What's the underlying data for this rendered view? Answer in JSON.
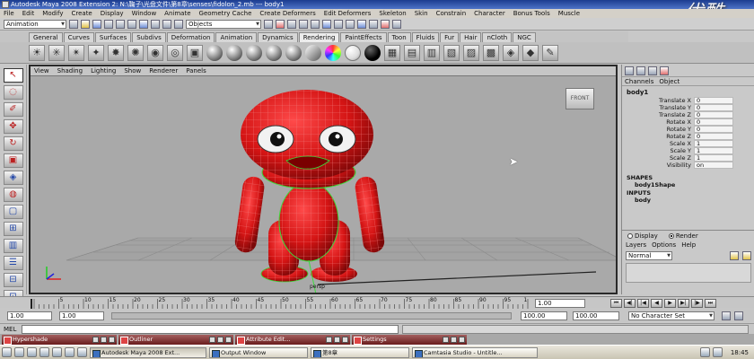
{
  "window": {
    "title": "Autodesk Maya 2008 Extension 2: N:\\鞠子\\光盘文件\\第8章\\senses\\fidolon_2.mb  ---  body1"
  },
  "watermark": "优酷",
  "menubar": [
    "File",
    "Edit",
    "Modify",
    "Create",
    "Display",
    "Window",
    "Animate",
    "Geometry Cache",
    "Create Deformers",
    "Edit Deformers",
    "Skeleton",
    "Skin",
    "Constrain",
    "Character",
    "Bonus Tools",
    "Muscle"
  ],
  "statusline": {
    "mode": "Animation",
    "selection_mode": "Objects"
  },
  "shelf_tabs": [
    "General",
    "Curves",
    "Surfaces",
    "Subdivs",
    "Deformation",
    "Animation",
    "Dynamics",
    "Rendering",
    "PaintEffects",
    "Toon",
    "Fluids",
    "Fur",
    "Hair",
    "nCloth",
    "NGC"
  ],
  "active_shelf_tab": "Rendering",
  "viewport": {
    "menu": [
      "View",
      "Shading",
      "Lighting",
      "Show",
      "Renderer",
      "Panels"
    ],
    "viewcube_label": "FRONT",
    "camera_label": "persp"
  },
  "channel_box": {
    "menu": [
      "Channels",
      "Object"
    ],
    "object": "body1",
    "attributes": [
      {
        "name": "Translate X",
        "value": "0"
      },
      {
        "name": "Translate Y",
        "value": "0"
      },
      {
        "name": "Translate Z",
        "value": "0"
      },
      {
        "name": "Rotate X",
        "value": "0"
      },
      {
        "name": "Rotate Y",
        "value": "0"
      },
      {
        "name": "Rotate Z",
        "value": "0"
      },
      {
        "name": "Scale X",
        "value": "1"
      },
      {
        "name": "Scale Y",
        "value": "1"
      },
      {
        "name": "Scale Z",
        "value": "1"
      },
      {
        "name": "Visibility",
        "value": "on"
      }
    ],
    "shapes_header": "SHAPES",
    "shape": "body1Shape",
    "inputs_header": "INPUTS",
    "input": "body"
  },
  "layers": {
    "radio_display": "Display",
    "radio_render": "Render",
    "menu": [
      "Layers",
      "Options",
      "Help"
    ],
    "layer_mode": "Normal"
  },
  "timeline": {
    "ticks": [
      "5",
      "10",
      "15",
      "20",
      "25",
      "30",
      "35",
      "40",
      "45",
      "50",
      "55",
      "60",
      "65",
      "70",
      "75",
      "80",
      "85",
      "90",
      "95",
      "1"
    ],
    "current_frame": "1.00",
    "range_start": "1.00",
    "range_inner_start": "1.00",
    "range_end": "100.00",
    "range_inner_end": "100.00",
    "character_set": "No Character Set"
  },
  "mel_label": "MEL",
  "minimized_windows": [
    "Hypershade",
    "Outliner",
    "Attribute Edit...",
    "Settings"
  ],
  "taskbar": {
    "tasks": [
      "Autodesk Maya 2008 Ext...",
      "Output Window",
      "第8章",
      "Camtasia Studio - Untitle..."
    ],
    "time": "18:45"
  }
}
